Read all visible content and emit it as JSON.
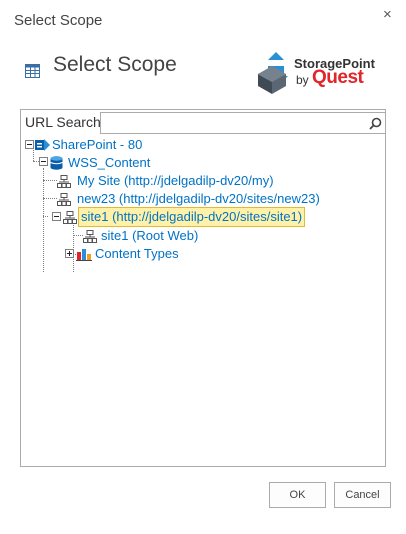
{
  "dialog": {
    "title": "Select Scope",
    "close_glyph": "×"
  },
  "header": {
    "title": "Select Scope",
    "icon": "list-grid-icon"
  },
  "logo": {
    "line1": "StoragePoint",
    "by": "by",
    "brand": "Quest"
  },
  "search": {
    "label": "URL Search",
    "value": "",
    "placeholder": "",
    "button_icon": "search-icon"
  },
  "tree": {
    "nodes": [
      {
        "label": "SharePoint - 80",
        "icon": "sharepoint-farm-icon",
        "expander": "collapse"
      },
      {
        "label": "WSS_Content",
        "icon": "database-icon",
        "expander": "collapse"
      },
      {
        "label": "My Site (http://jdelgadilp-dv20/my)",
        "icon": "site-collection-icon"
      },
      {
        "label": "new23 (http://jdelgadilp-dv20/sites/new23)",
        "icon": "site-collection-icon"
      },
      {
        "label": "site1 (http://jdelgadilp-dv20/sites/site1)",
        "icon": "site-collection-icon",
        "expander": "collapse",
        "selected": true
      },
      {
        "label": "site1 (Root Web)",
        "icon": "web-icon"
      },
      {
        "label": "Content Types",
        "icon": "content-types-icon",
        "expander": "expand"
      }
    ]
  },
  "buttons": {
    "ok": "OK",
    "cancel": "Cancel"
  },
  "colors": {
    "link": "#0072c6",
    "selection_bg": "#fff2a8",
    "selection_border": "#e2b83b",
    "brand_red": "#e0252b"
  }
}
